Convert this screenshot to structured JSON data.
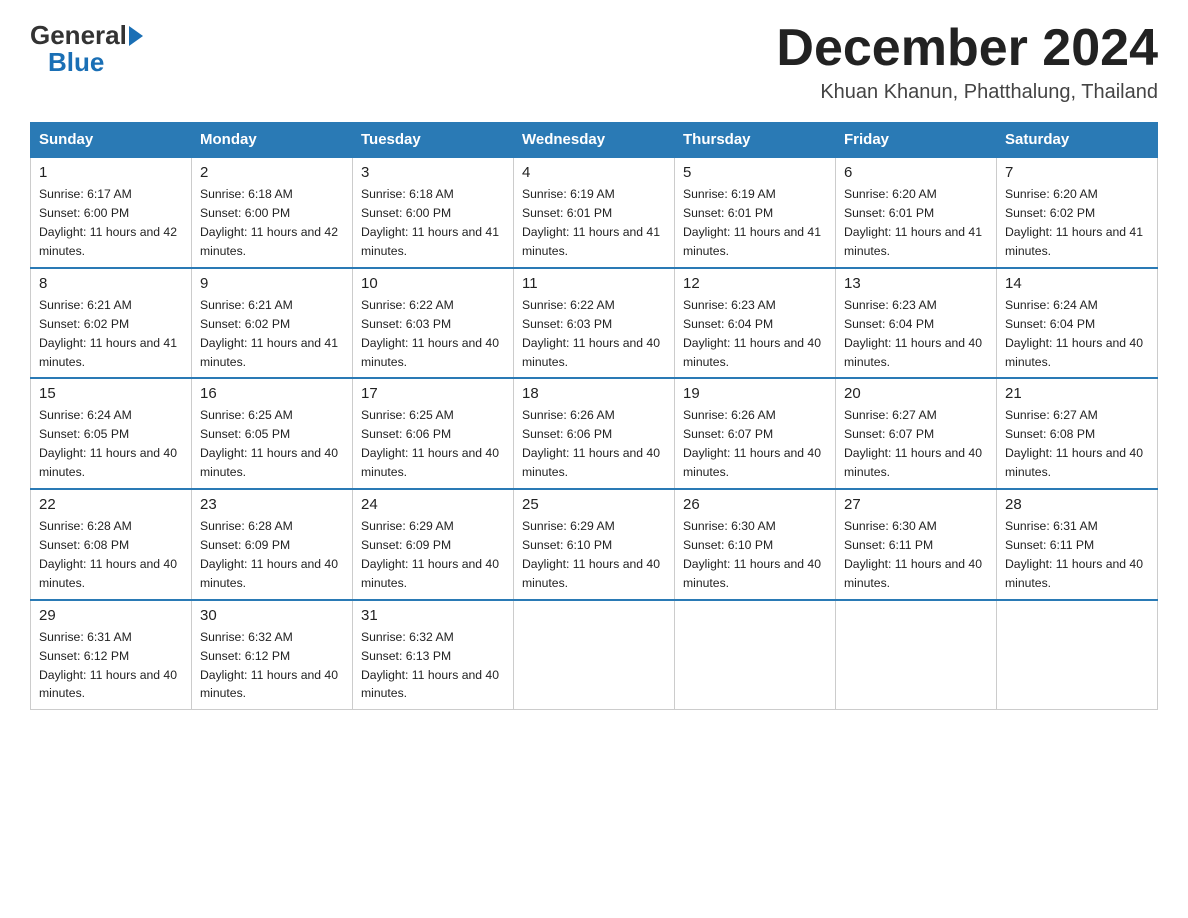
{
  "header": {
    "logo_general": "General",
    "logo_blue": "Blue",
    "month_title": "December 2024",
    "location": "Khuan Khanun, Phatthalung, Thailand"
  },
  "days_of_week": [
    "Sunday",
    "Monday",
    "Tuesday",
    "Wednesday",
    "Thursday",
    "Friday",
    "Saturday"
  ],
  "weeks": [
    [
      {
        "day": "1",
        "sunrise": "6:17 AM",
        "sunset": "6:00 PM",
        "daylight": "11 hours and 42 minutes."
      },
      {
        "day": "2",
        "sunrise": "6:18 AM",
        "sunset": "6:00 PM",
        "daylight": "11 hours and 42 minutes."
      },
      {
        "day": "3",
        "sunrise": "6:18 AM",
        "sunset": "6:00 PM",
        "daylight": "11 hours and 41 minutes."
      },
      {
        "day": "4",
        "sunrise": "6:19 AM",
        "sunset": "6:01 PM",
        "daylight": "11 hours and 41 minutes."
      },
      {
        "day": "5",
        "sunrise": "6:19 AM",
        "sunset": "6:01 PM",
        "daylight": "11 hours and 41 minutes."
      },
      {
        "day": "6",
        "sunrise": "6:20 AM",
        "sunset": "6:01 PM",
        "daylight": "11 hours and 41 minutes."
      },
      {
        "day": "7",
        "sunrise": "6:20 AM",
        "sunset": "6:02 PM",
        "daylight": "11 hours and 41 minutes."
      }
    ],
    [
      {
        "day": "8",
        "sunrise": "6:21 AM",
        "sunset": "6:02 PM",
        "daylight": "11 hours and 41 minutes."
      },
      {
        "day": "9",
        "sunrise": "6:21 AM",
        "sunset": "6:02 PM",
        "daylight": "11 hours and 41 minutes."
      },
      {
        "day": "10",
        "sunrise": "6:22 AM",
        "sunset": "6:03 PM",
        "daylight": "11 hours and 40 minutes."
      },
      {
        "day": "11",
        "sunrise": "6:22 AM",
        "sunset": "6:03 PM",
        "daylight": "11 hours and 40 minutes."
      },
      {
        "day": "12",
        "sunrise": "6:23 AM",
        "sunset": "6:04 PM",
        "daylight": "11 hours and 40 minutes."
      },
      {
        "day": "13",
        "sunrise": "6:23 AM",
        "sunset": "6:04 PM",
        "daylight": "11 hours and 40 minutes."
      },
      {
        "day": "14",
        "sunrise": "6:24 AM",
        "sunset": "6:04 PM",
        "daylight": "11 hours and 40 minutes."
      }
    ],
    [
      {
        "day": "15",
        "sunrise": "6:24 AM",
        "sunset": "6:05 PM",
        "daylight": "11 hours and 40 minutes."
      },
      {
        "day": "16",
        "sunrise": "6:25 AM",
        "sunset": "6:05 PM",
        "daylight": "11 hours and 40 minutes."
      },
      {
        "day": "17",
        "sunrise": "6:25 AM",
        "sunset": "6:06 PM",
        "daylight": "11 hours and 40 minutes."
      },
      {
        "day": "18",
        "sunrise": "6:26 AM",
        "sunset": "6:06 PM",
        "daylight": "11 hours and 40 minutes."
      },
      {
        "day": "19",
        "sunrise": "6:26 AM",
        "sunset": "6:07 PM",
        "daylight": "11 hours and 40 minutes."
      },
      {
        "day": "20",
        "sunrise": "6:27 AM",
        "sunset": "6:07 PM",
        "daylight": "11 hours and 40 minutes."
      },
      {
        "day": "21",
        "sunrise": "6:27 AM",
        "sunset": "6:08 PM",
        "daylight": "11 hours and 40 minutes."
      }
    ],
    [
      {
        "day": "22",
        "sunrise": "6:28 AM",
        "sunset": "6:08 PM",
        "daylight": "11 hours and 40 minutes."
      },
      {
        "day": "23",
        "sunrise": "6:28 AM",
        "sunset": "6:09 PM",
        "daylight": "11 hours and 40 minutes."
      },
      {
        "day": "24",
        "sunrise": "6:29 AM",
        "sunset": "6:09 PM",
        "daylight": "11 hours and 40 minutes."
      },
      {
        "day": "25",
        "sunrise": "6:29 AM",
        "sunset": "6:10 PM",
        "daylight": "11 hours and 40 minutes."
      },
      {
        "day": "26",
        "sunrise": "6:30 AM",
        "sunset": "6:10 PM",
        "daylight": "11 hours and 40 minutes."
      },
      {
        "day": "27",
        "sunrise": "6:30 AM",
        "sunset": "6:11 PM",
        "daylight": "11 hours and 40 minutes."
      },
      {
        "day": "28",
        "sunrise": "6:31 AM",
        "sunset": "6:11 PM",
        "daylight": "11 hours and 40 minutes."
      }
    ],
    [
      {
        "day": "29",
        "sunrise": "6:31 AM",
        "sunset": "6:12 PM",
        "daylight": "11 hours and 40 minutes."
      },
      {
        "day": "30",
        "sunrise": "6:32 AM",
        "sunset": "6:12 PM",
        "daylight": "11 hours and 40 minutes."
      },
      {
        "day": "31",
        "sunrise": "6:32 AM",
        "sunset": "6:13 PM",
        "daylight": "11 hours and 40 minutes."
      },
      null,
      null,
      null,
      null
    ]
  ]
}
